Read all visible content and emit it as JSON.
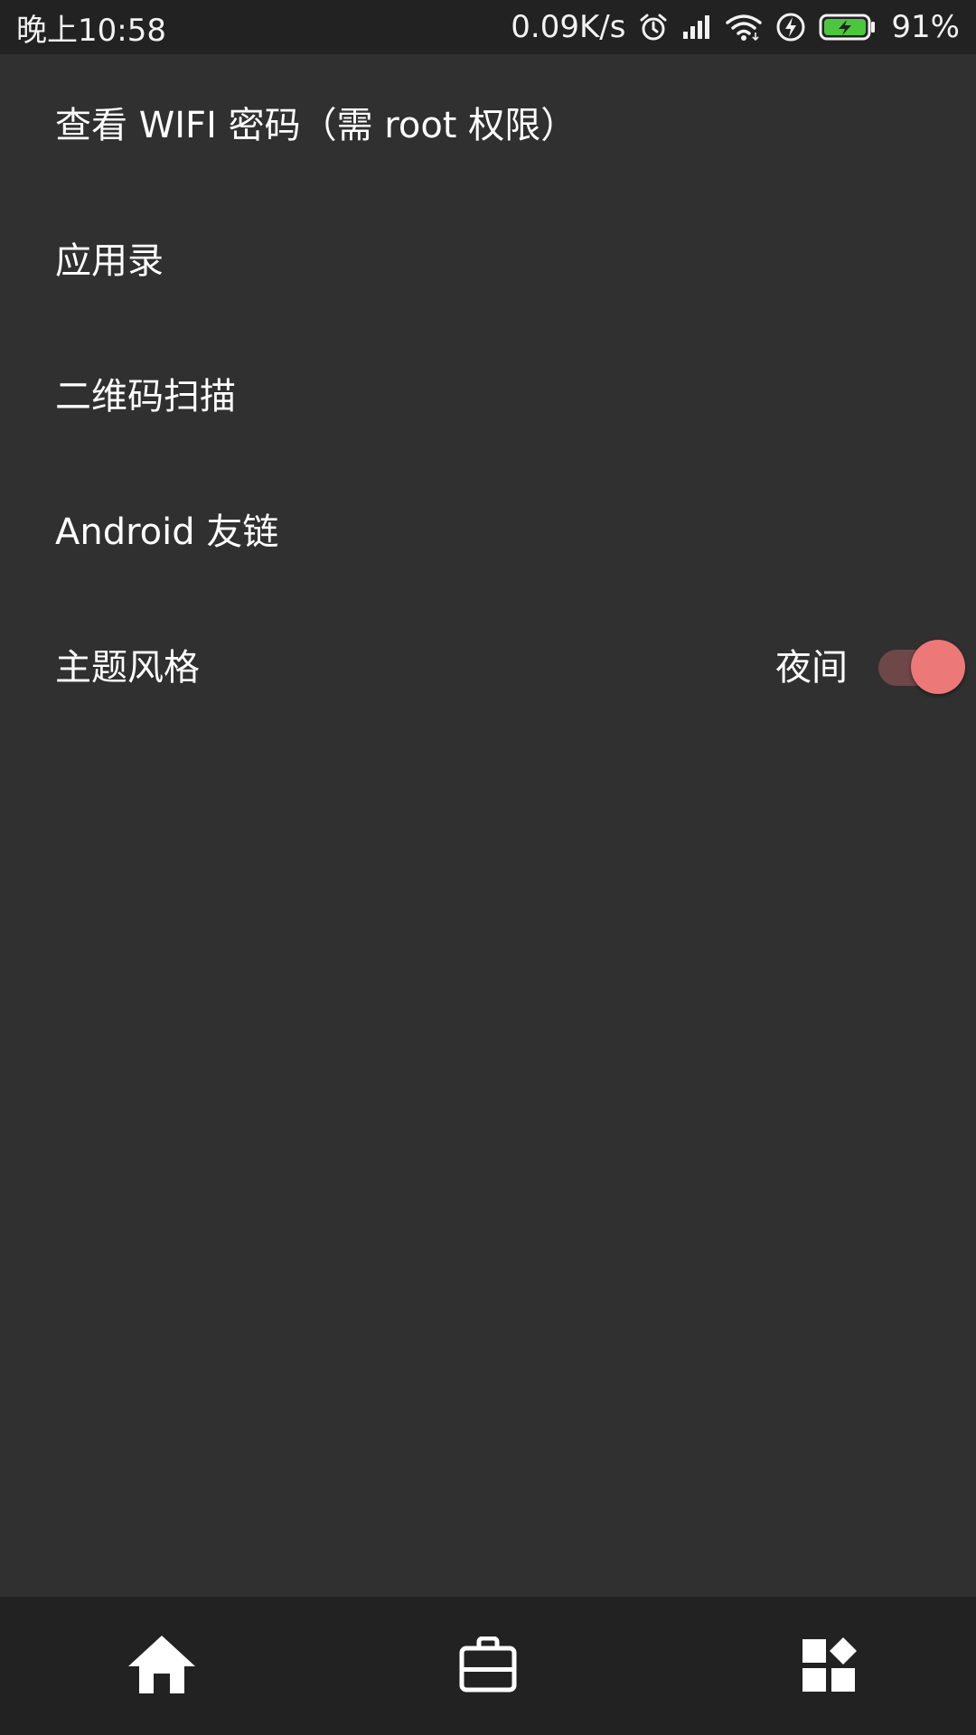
{
  "status_bar": {
    "time": "晚上10:58",
    "net_speed": "0.09K/s",
    "battery_percent": "91%",
    "icons": [
      "alarm-icon",
      "signal-icon",
      "wifi-icon",
      "charging-icon",
      "battery-icon"
    ],
    "battery_color": "#4cc63f"
  },
  "settings": {
    "items": [
      {
        "label": "查看 WIFI 密码（需 root 权限）"
      },
      {
        "label": "应用录"
      },
      {
        "label": "二维码扫描"
      },
      {
        "label": "Android 友链"
      },
      {
        "label": "主题风格",
        "value": "夜间",
        "toggle_on": true
      }
    ]
  },
  "bottom_nav": {
    "items": [
      {
        "icon": "home-icon"
      },
      {
        "icon": "briefcase-icon"
      },
      {
        "icon": "widgets-icon"
      }
    ]
  },
  "colors": {
    "background": "#303030",
    "bars": "#222222",
    "accent": "#ec7878",
    "toggle_track": "#6e4749"
  }
}
